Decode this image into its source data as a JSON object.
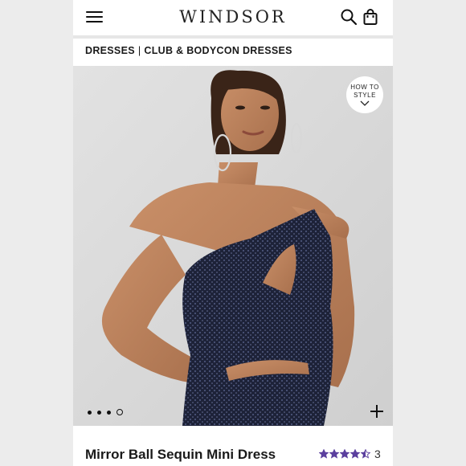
{
  "header": {
    "logo": "WINDSOR",
    "menu_icon": "hamburger-menu-icon",
    "search_icon": "search-icon",
    "bag_icon": "shopping-bag-icon"
  },
  "breadcrumb": {
    "items": [
      "DRESSES",
      "CLUB & BODYCON DRESSES"
    ],
    "separator": "|"
  },
  "hero": {
    "how_to_style_line1": "HOW TO",
    "how_to_style_line2": "STYLE",
    "carousel_count": 4,
    "carousel_active": 3,
    "zoom_icon": "plus-icon"
  },
  "product": {
    "title": "Mirror Ball Sequin Mini Dress",
    "rating": 4.5,
    "review_count": "3"
  },
  "colors": {
    "star": "#5b3f9e",
    "dress": "#1d2238",
    "background": "#ececec"
  }
}
